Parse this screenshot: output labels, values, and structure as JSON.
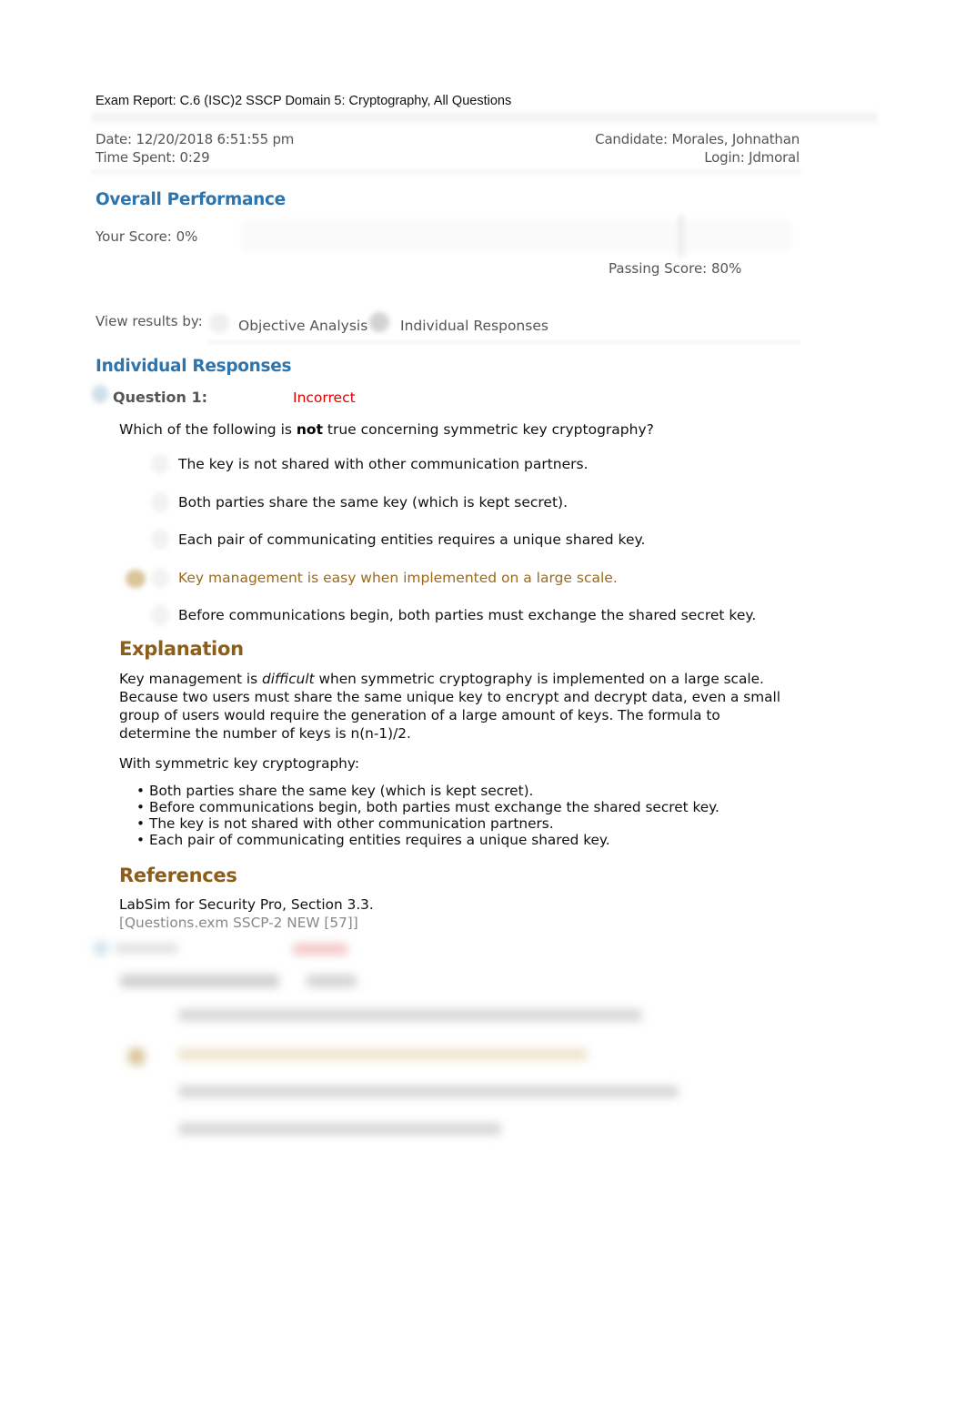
{
  "report": {
    "title": "Exam Report: C.6 (ISC)2 SSCP Domain 5: Cryptography, All Questions",
    "date": "Date: 12/20/2018 6:51:55 pm",
    "time_spent": "Time Spent: 0:29",
    "candidate": "Candidate: Morales, Johnathan",
    "login": "Login: Jdmoral"
  },
  "overall": {
    "heading": "Overall Performance",
    "your_score_label": "Your Score: 0%",
    "your_score_pct": 0,
    "passing_score_label": "Passing Score: 80%",
    "passing_score_pct": 80
  },
  "view": {
    "label": "View results by:",
    "options": [
      {
        "label": "Objective Analysis",
        "selected": false
      },
      {
        "label": "Individual Responses",
        "selected": true
      }
    ]
  },
  "individual": {
    "heading": "Individual Responses",
    "questions": [
      {
        "label": "Question 1:",
        "status": "Incorrect",
        "status_color": "#e00000",
        "text_pre": "Which of the following is ",
        "text_bold": "not",
        "text_post": " true concerning symmetric key cryptography?",
        "choices": [
          {
            "text": "The key is not shared with other communication partners.",
            "selected": false
          },
          {
            "text": "Both parties share the same key (which is kept secret).",
            "selected": false
          },
          {
            "text": "Each pair of communicating entities requires a unique shared key.",
            "selected": false
          },
          {
            "text": "Key management is easy when implemented on a large scale.",
            "selected": true
          },
          {
            "text": "Before communications begin, both parties must exchange the shared secret key.",
            "selected": false
          }
        ],
        "explanation": {
          "heading": "Explanation",
          "p1_pre": "Key management is ",
          "p1_italic": "difficult",
          "p1_post": " when symmetric cryptography is implemented on a large scale. Because two users must share the same unique key to encrypt and decrypt data, even a small group of users would require the generation of a large amount of keys. The formula to determine the number of keys is n(n-1)/2.",
          "p2": "With symmetric key cryptography:",
          "bullets": [
            "Both parties share the same key (which is kept secret).",
            "Before communications begin, both parties must exchange the shared secret key.",
            "The key is not shared with other communication partners.",
            "Each pair of communicating entities requires a unique shared key."
          ]
        },
        "references": {
          "heading": "References",
          "text": "LabSim for Security Pro, Section 3.3.",
          "source": "[Questions.exm SSCP-2 NEW [57]]"
        }
      }
    ]
  },
  "colors": {
    "heading_blue": "#2e74ad",
    "heading_brown": "#8b5e1a",
    "selected_choice": "#9a6a1e",
    "incorrect_red": "#e00000"
  }
}
